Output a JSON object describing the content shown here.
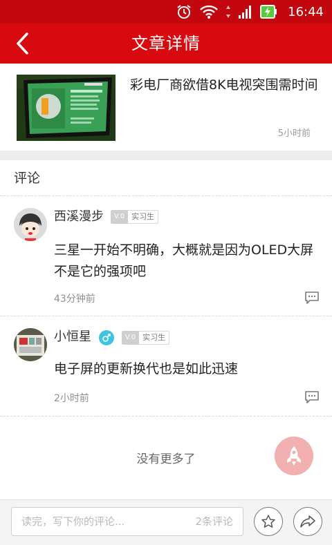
{
  "status_bar": {
    "time": "16:44"
  },
  "header": {
    "title": "文章详情"
  },
  "article": {
    "headline": "彩电厂商欲借8K电视突围需时间",
    "time": "5小时前"
  },
  "comments_section": {
    "title": "评论"
  },
  "comments": [
    {
      "username": "西溪漫步",
      "level": "V.0",
      "rank": "实习生",
      "text": "三星一开始不明确，大概就是因为OLED大屏不是它的强项吧",
      "time": "43分钟前"
    },
    {
      "username": "小恒星",
      "gender": "male",
      "level": "V.0",
      "rank": "实习生",
      "text": "电子屏的更新换代也是如此迅速",
      "time": "2小时前"
    }
  ],
  "list_end": {
    "text": "没有更多了"
  },
  "bottom_bar": {
    "input_placeholder": "读完，写下你的评论...",
    "comment_count": "2条评论"
  },
  "colors": {
    "header_red": "#d80a10",
    "status_red": "#c2070e",
    "gender_blue": "#3ec4e0",
    "rocket_pink": "#f3b0b0"
  }
}
